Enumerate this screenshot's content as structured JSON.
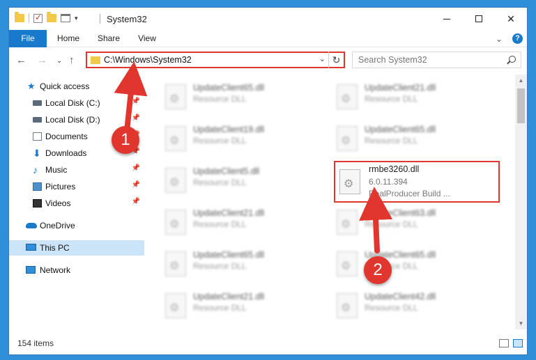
{
  "window": {
    "title": "System32"
  },
  "ribbon": {
    "tabs": [
      "File",
      "Home",
      "Share",
      "View"
    ]
  },
  "address": {
    "path": "C:\\Windows\\System32"
  },
  "search": {
    "placeholder": "Search System32"
  },
  "sidebar": {
    "items": [
      {
        "label": "Quick access",
        "icon": "star-icon"
      },
      {
        "label": "Local Disk (C:)",
        "icon": "drive-icon"
      },
      {
        "label": "Local Disk (D:)",
        "icon": "drive-icon"
      },
      {
        "label": "Documents",
        "icon": "documents-icon"
      },
      {
        "label": "Downloads",
        "icon": "downloads-icon"
      },
      {
        "label": "Music",
        "icon": "music-icon"
      },
      {
        "label": "Pictures",
        "icon": "pictures-icon"
      },
      {
        "label": "Videos",
        "icon": "videos-icon"
      },
      {
        "label": "OneDrive",
        "icon": "onedrive-icon"
      },
      {
        "label": "This PC",
        "icon": "pc-icon",
        "selected": true
      },
      {
        "label": "Network",
        "icon": "network-icon"
      }
    ]
  },
  "files": [
    {
      "name": "UpdateClient65.dll",
      "desc": "Resource DLL"
    },
    {
      "name": "UpdateClient21.dll",
      "desc": "Resource DLL"
    },
    {
      "name": "UpdateClient19.dll",
      "desc": "Resource DLL"
    },
    {
      "name": "UpdateClient65.dll",
      "desc": "Resource DLL"
    },
    {
      "name": "UpdateClient5.dll",
      "desc": "Resource DLL"
    },
    {
      "name": "rmbe3260.dll",
      "desc": "6.0.11.394",
      "extra": "RealProducer Build ..."
    },
    {
      "name": "UpdateClient21.dll",
      "desc": "Resource DLL"
    },
    {
      "name": "UpdateClient63.dll",
      "desc": "Resource DLL"
    },
    {
      "name": "UpdateClient65.dll",
      "desc": "Resource DLL"
    },
    {
      "name": "UpdateClient65.dll",
      "desc": "Resource DLL"
    },
    {
      "name": "UpdateClient21.dll",
      "desc": "Resource DLL"
    },
    {
      "name": "UpdateClient42.dll",
      "desc": "Resource DLL"
    }
  ],
  "status": {
    "count": "154 items"
  },
  "annotations": {
    "step1": "1",
    "step2": "2",
    "color": "#e0362e"
  }
}
